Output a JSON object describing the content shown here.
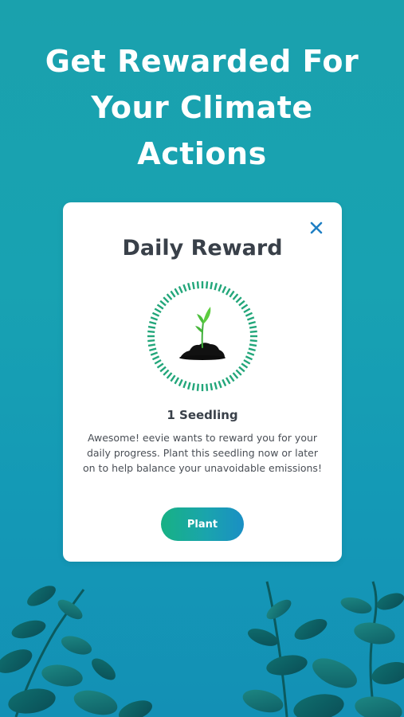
{
  "headline": {
    "line1": "Get Rewarded For",
    "line2": "Your Climate",
    "line3": "Actions"
  },
  "modal": {
    "title": "Daily Reward",
    "close_icon": "close-icon",
    "reward_icon": "seedling-icon",
    "reward_name": "1 Seedling",
    "description": "Awesome! eevie wants to reward you for your daily progress. Plant this seedling now or later on to help balance your unavoidable emissions!",
    "plant_label": "Plant"
  },
  "colors": {
    "background_top": "#1aa1ad",
    "background_bottom": "#1390b5",
    "accent_green": "#22a67a",
    "close_blue": "#1f7fc4",
    "title_text": "#394049"
  }
}
